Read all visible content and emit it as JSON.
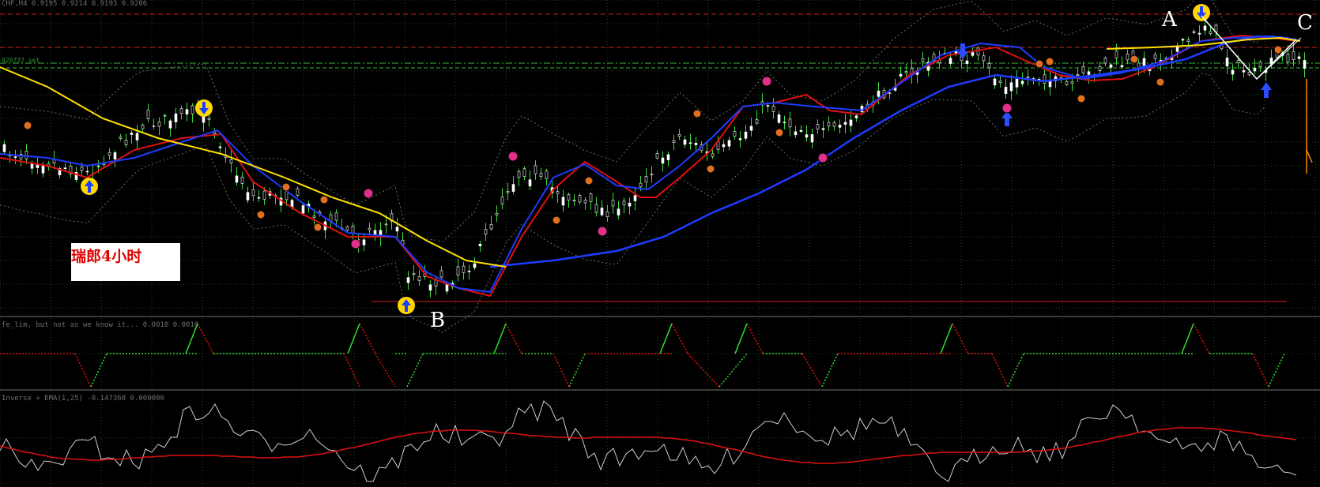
{
  "window": {
    "main_title": "CHF,H4  0.9195 0.9214 0.9193 0.9206",
    "price_tag": "920737 set"
  },
  "annotations": {
    "note": "瑞郎4小时",
    "label_a": "A",
    "label_b": "B",
    "label_c": "C"
  },
  "indicators": {
    "oscillator_title": "fe_lim, but not as we know it...  0.0010 0.0010",
    "inverse_title": "Inverse + EMA(1,25) -0.147368 0.000000"
  },
  "colors": {
    "background": "#000000",
    "grid": "#1f4a1f",
    "candle": "#ffffff",
    "wick": "#3ddc3d",
    "ma_red": "#e01010",
    "ma_blue": "#1e3cff",
    "ma_yellow": "#ffe100",
    "envelope": "#6a6a6a",
    "resistance": "#d42020",
    "support_green": "#3ab93a",
    "arrow_gold": "#ffd800",
    "arrow_blue": "#2a4dff",
    "marker_orange": "#e07020",
    "marker_magenta": "#e0308a",
    "step_up": "#2ee02e",
    "step_down": "#e81010",
    "inverse_line": "#d0d0d0",
    "ema_line": "#e01010"
  },
  "chart_data": {
    "type": "line",
    "symbol": "CHF",
    "timeframe": "H4",
    "quote": {
      "open": 0.9195,
      "high": 0.9214,
      "low": 0.9193,
      "close": 0.9206
    },
    "series": [
      {
        "name": "Inverse + EMA(1,25)",
        "values": [
          -0.147368,
          0.0
        ]
      }
    ],
    "markers": [
      {
        "label": "A",
        "kind": "swing high"
      },
      {
        "label": "B",
        "kind": "swing low"
      },
      {
        "label": "C",
        "kind": "projection"
      }
    ]
  }
}
